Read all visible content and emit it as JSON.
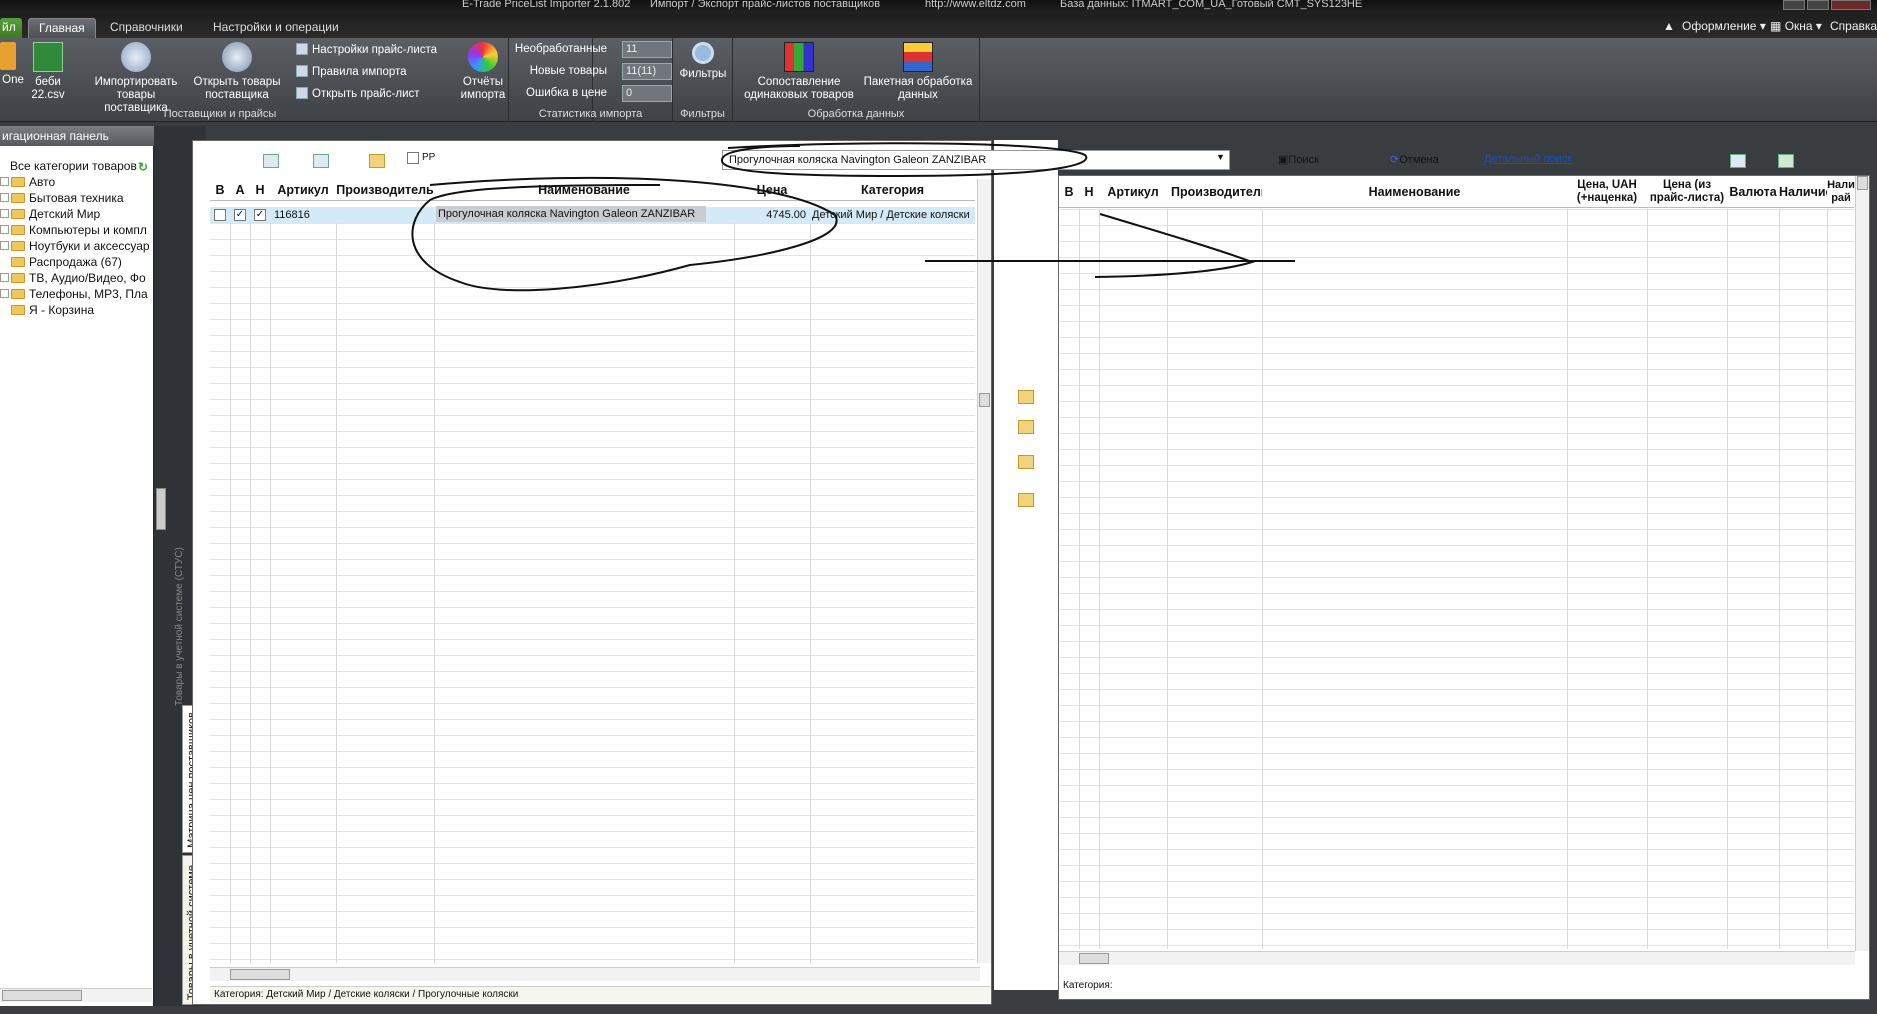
{
  "window": {
    "title_fragments": [
      "E-Trade PriceList Importer 2.1.802",
      "Импорт / Экспорт прайс-листов поставщиков",
      "http://www.eltdz.com",
      "База данных: ITMART_COM_UA_Готовый СМТ_SYS123HE"
    ]
  },
  "ribbon_tabs": {
    "file": "йл",
    "main": "Главная",
    "reference": "Справочники",
    "settings": "Настройки и операции",
    "right_design": "Оформление",
    "right_windows": "Окна",
    "right_help": "Справка"
  },
  "ribbon": {
    "btn_one": "One",
    "btn_file": "беби 22.csv",
    "import_goods": "Импортировать товары поставщика",
    "open_goods": "Открыть товары поставщика",
    "pricelist_settings": "Настройки прайс-листа",
    "import_rules": "Правила импорта",
    "open_pricelist": "Открыть прайс-лист",
    "group_suppliers": "Поставщики и прайсы",
    "import_reports": "Отчёты импорта",
    "stat_unprocessed_label": "Необработанные",
    "stat_unprocessed_value": "11",
    "stat_new_label": "Новые товары",
    "stat_new_value": "11(11)",
    "stat_price_error_label": "Ошибка в цене",
    "stat_price_error_value": "0",
    "group_stats": "Статистика импорта",
    "filters": "Фильтры",
    "group_filters": "Фильтры",
    "compare": "Сопоставление одинаковых товаров",
    "batch": "Пакетная обработка данных",
    "group_data": "Обработка данных"
  },
  "nav": {
    "header": "игационная панель",
    "items": [
      "Все категории товаров",
      "Авто",
      "Бытовая техника",
      "Детский Мир",
      "Компьютеры и компл",
      "Ноутбуки и аксессуар",
      "Распродажа (67)",
      "ТВ, Аудио/Видео, Фо",
      "Телефоны, MP3, Пла",
      "Я - Корзина"
    ]
  },
  "vertical_tabs": {
    "system_goods_faded": "Товары в учетной системе (СТУС)",
    "price_matrix": "Матрица цен поставщиков",
    "system_goods": "Товары в учетной системе"
  },
  "left_pane": {
    "rr_label": "РР",
    "columns": [
      "В",
      "А",
      "Н",
      "Артикул",
      "Производитель",
      "Наименование",
      "Цена",
      "Категория"
    ],
    "rows": [
      {
        "sku": "116816",
        "manufacturer": "",
        "name": "Прогулочная коляска Navington Galeon ZANZIBAR",
        "price": "4745.00",
        "category": "Детский Мир / Детские коляски",
        "b": false,
        "a": true,
        "n": true
      }
    ],
    "status": "Категория: Детский Мир / Детские коляски / Прогулочные коляски"
  },
  "right_pane": {
    "search_value": "Прогулочная коляска Navington Galeon ZANZIBAR",
    "search_button": "Поиск",
    "cancel_button": "Отмена",
    "detailed_search": "Детальный поиск",
    "columns": [
      "В",
      "Н",
      "Артикул",
      "Производитель",
      "Наименование",
      "Цена, UAH (+наценка)",
      "Цена (из прайс-листа)",
      "Валюта",
      "Наличие",
      "Нали рай"
    ],
    "status": "Категория:"
  }
}
